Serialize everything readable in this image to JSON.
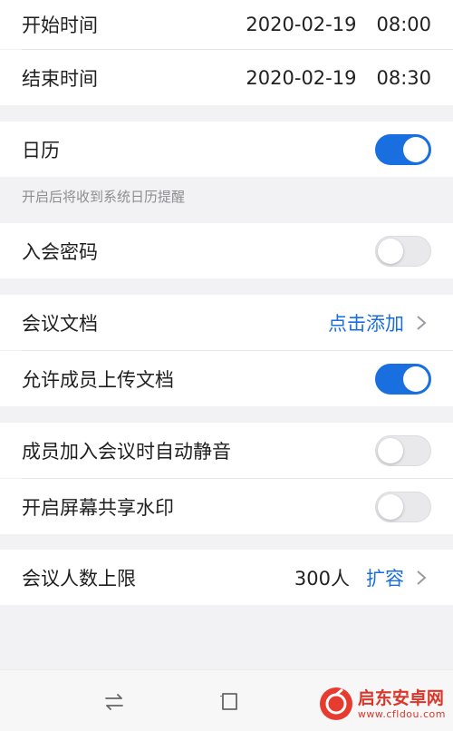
{
  "schedule": {
    "start": {
      "label": "开始时间",
      "date": "2020-02-19",
      "time": "08:00"
    },
    "end": {
      "label": "结束时间",
      "date": "2020-02-19",
      "time": "08:30"
    }
  },
  "calendar": {
    "label": "日历",
    "enabled": true,
    "hint": "开启后将收到系统日历提醒"
  },
  "password": {
    "label": "入会密码",
    "enabled": false
  },
  "documents": {
    "label": "会议文档",
    "action": "点击添加"
  },
  "allow_upload": {
    "label": "允许成员上传文档",
    "enabled": true
  },
  "mute_on_join": {
    "label": "成员加入会议时自动静音",
    "enabled": false
  },
  "watermark": {
    "label": "开启屏幕共享水印",
    "enabled": false
  },
  "capacity": {
    "label": "会议人数上限",
    "value": "300人",
    "action": "扩容"
  },
  "site_watermark": {
    "title": "启东安卓网",
    "url": "www.cfldou.com"
  },
  "colors": {
    "accent": "#1a6fe0",
    "toggle_off": "#e9e9ec",
    "background": "#f2f2f4"
  }
}
